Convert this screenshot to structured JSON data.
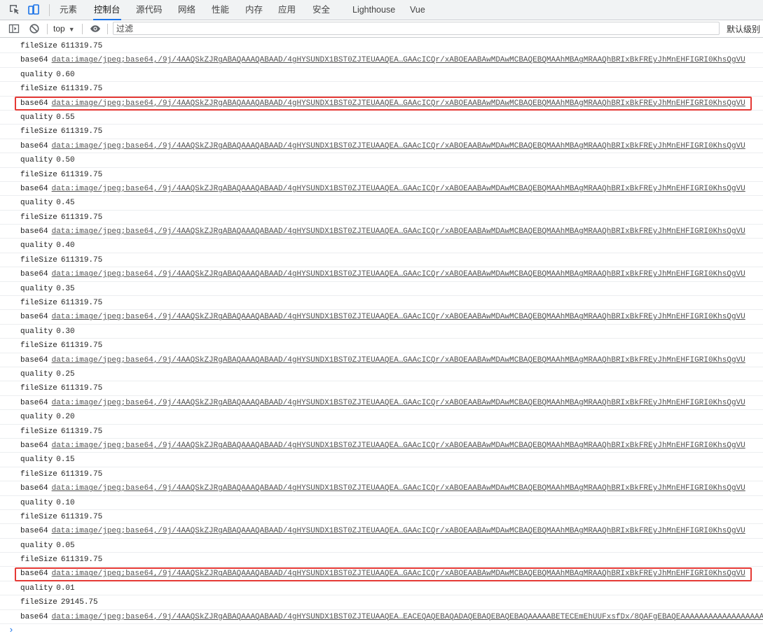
{
  "tabs": [
    {
      "label": "元素",
      "active": false
    },
    {
      "label": "控制台",
      "active": true
    },
    {
      "label": "源代码",
      "active": false
    },
    {
      "label": "网络",
      "active": false
    },
    {
      "label": "性能",
      "active": false
    },
    {
      "label": "内存",
      "active": false
    },
    {
      "label": "应用",
      "active": false
    },
    {
      "label": "安全",
      "active": false
    },
    {
      "label": "Lighthouse",
      "active": false
    },
    {
      "label": "Vue",
      "active": false
    }
  ],
  "toolbar": {
    "context": "top",
    "filter_placeholder": "过滤",
    "levels_label": "默认级别"
  },
  "colors": {
    "accent": "#1a73e8",
    "highlight": "#e53935"
  },
  "messages": [
    {
      "key": "fileSize",
      "value": "611319.75"
    },
    {
      "key": "base64",
      "value": "data:image/jpeg;base64,/9j/4AAQSkZJRgABAQAAAQABAAD/4gHYSUNDX1BST0ZJTEUAAQEA…GAAcICQr/xABOEAABAwMDAwMCBAQEBQMAAhMBAgMRAAQhBRIxBkFREyJhMnEHFIGRI0KhsQgVU",
      "link": true
    },
    {
      "key": "quality",
      "value": "0.60"
    },
    {
      "key": "fileSize",
      "value": "611319.75"
    },
    {
      "key": "base64",
      "value": "data:image/jpeg;base64,/9j/4AAQSkZJRgABAQAAAQABAAD/4gHYSUNDX1BST0ZJTEUAAQEA…GAAcICQr/xABOEAABAwMDAwMCBAQEBQMAAhMBAgMRAAQhBRIxBkFREyJhMnEHFIGRI0KhsQgVU",
      "link": true,
      "highlighted": true
    },
    {
      "key": "quality",
      "value": "0.55"
    },
    {
      "key": "fileSize",
      "value": "611319.75"
    },
    {
      "key": "base64",
      "value": "data:image/jpeg;base64,/9j/4AAQSkZJRgABAQAAAQABAAD/4gHYSUNDX1BST0ZJTEUAAQEA…GAAcICQr/xABOEAABAwMDAwMCBAQEBQMAAhMBAgMRAAQhBRIxBkFREyJhMnEHFIGRI0KhsQgVU",
      "link": true
    },
    {
      "key": "quality",
      "value": "0.50"
    },
    {
      "key": "fileSize",
      "value": "611319.75"
    },
    {
      "key": "base64",
      "value": "data:image/jpeg;base64,/9j/4AAQSkZJRgABAQAAAQABAAD/4gHYSUNDX1BST0ZJTEUAAQEA…GAAcICQr/xABOEAABAwMDAwMCBAQEBQMAAhMBAgMRAAQhBRIxBkFREyJhMnEHFIGRI0KhsQgVU",
      "link": true
    },
    {
      "key": "quality",
      "value": "0.45"
    },
    {
      "key": "fileSize",
      "value": "611319.75"
    },
    {
      "key": "base64",
      "value": "data:image/jpeg;base64,/9j/4AAQSkZJRgABAQAAAQABAAD/4gHYSUNDX1BST0ZJTEUAAQEA…GAAcICQr/xABOEAABAwMDAwMCBAQEBQMAAhMBAgMRAAQhBRIxBkFREyJhMnEHFIGRI0KhsQgVU",
      "link": true
    },
    {
      "key": "quality",
      "value": "0.40"
    },
    {
      "key": "fileSize",
      "value": "611319.75"
    },
    {
      "key": "base64",
      "value": "data:image/jpeg;base64,/9j/4AAQSkZJRgABAQAAAQABAAD/4gHYSUNDX1BST0ZJTEUAAQEA…GAAcICQr/xABOEAABAwMDAwMCBAQEBQMAAhMBAgMRAAQhBRIxBkFREyJhMnEHFIGRI0KhsQgVU",
      "link": true
    },
    {
      "key": "quality",
      "value": "0.35"
    },
    {
      "key": "fileSize",
      "value": "611319.75"
    },
    {
      "key": "base64",
      "value": "data:image/jpeg;base64,/9j/4AAQSkZJRgABAQAAAQABAAD/4gHYSUNDX1BST0ZJTEUAAQEA…GAAcICQr/xABOEAABAwMDAwMCBAQEBQMAAhMBAgMRAAQhBRIxBkFREyJhMnEHFIGRI0KhsQgVU",
      "link": true
    },
    {
      "key": "quality",
      "value": "0.30"
    },
    {
      "key": "fileSize",
      "value": "611319.75"
    },
    {
      "key": "base64",
      "value": "data:image/jpeg;base64,/9j/4AAQSkZJRgABAQAAAQABAAD/4gHYSUNDX1BST0ZJTEUAAQEA…GAAcICQr/xABOEAABAwMDAwMCBAQEBQMAAhMBAgMRAAQhBRIxBkFREyJhMnEHFIGRI0KhsQgVU",
      "link": true
    },
    {
      "key": "quality",
      "value": "0.25"
    },
    {
      "key": "fileSize",
      "value": "611319.75"
    },
    {
      "key": "base64",
      "value": "data:image/jpeg;base64,/9j/4AAQSkZJRgABAQAAAQABAAD/4gHYSUNDX1BST0ZJTEUAAQEA…GAAcICQr/xABOEAABAwMDAwMCBAQEBQMAAhMBAgMRAAQhBRIxBkFREyJhMnEHFIGRI0KhsQgVU",
      "link": true
    },
    {
      "key": "quality",
      "value": "0.20"
    },
    {
      "key": "fileSize",
      "value": "611319.75"
    },
    {
      "key": "base64",
      "value": "data:image/jpeg;base64,/9j/4AAQSkZJRgABAQAAAQABAAD/4gHYSUNDX1BST0ZJTEUAAQEA…GAAcICQr/xABOEAABAwMDAwMCBAQEBQMAAhMBAgMRAAQhBRIxBkFREyJhMnEHFIGRI0KhsQgVU",
      "link": true
    },
    {
      "key": "quality",
      "value": "0.15"
    },
    {
      "key": "fileSize",
      "value": "611319.75"
    },
    {
      "key": "base64",
      "value": "data:image/jpeg;base64,/9j/4AAQSkZJRgABAQAAAQABAAD/4gHYSUNDX1BST0ZJTEUAAQEA…GAAcICQr/xABOEAABAwMDAwMCBAQEBQMAAhMBAgMRAAQhBRIxBkFREyJhMnEHFIGRI0KhsQgVU",
      "link": true
    },
    {
      "key": "quality",
      "value": "0.10"
    },
    {
      "key": "fileSize",
      "value": "611319.75"
    },
    {
      "key": "base64",
      "value": "data:image/jpeg;base64,/9j/4AAQSkZJRgABAQAAAQABAAD/4gHYSUNDX1BST0ZJTEUAAQEA…GAAcICQr/xABOEAABAwMDAwMCBAQEBQMAAhMBAgMRAAQhBRIxBkFREyJhMnEHFIGRI0KhsQgVU",
      "link": true
    },
    {
      "key": "quality",
      "value": "0.05"
    },
    {
      "key": "fileSize",
      "value": "611319.75"
    },
    {
      "key": "base64",
      "value": "data:image/jpeg;base64,/9j/4AAQSkZJRgABAQAAAQABAAD/4gHYSUNDX1BST0ZJTEUAAQEA…GAAcICQr/xABOEAABAwMDAwMCBAQEBQMAAhMBAgMRAAQhBRIxBkFREyJhMnEHFIGRI0KhsQgVU",
      "link": true,
      "highlighted": true
    },
    {
      "key": "quality",
      "value": "0.01"
    },
    {
      "key": "fileSize",
      "value": "29145.75"
    },
    {
      "key": "base64",
      "value": "data:image/jpeg;base64,/9j/4AAQSkZJRgABAQAAAQABAAD/4gHYSUNDX1BST0ZJTEUAAQEA…EACEQAQEBAQADAQEBAQEBAQEBAQAAAAABETECEmEhUUFxsfDx/8QAFgEBAQEAAAAAAAAAAAAAAAAAAA",
      "link": true
    }
  ],
  "prompt_symbol": "›"
}
